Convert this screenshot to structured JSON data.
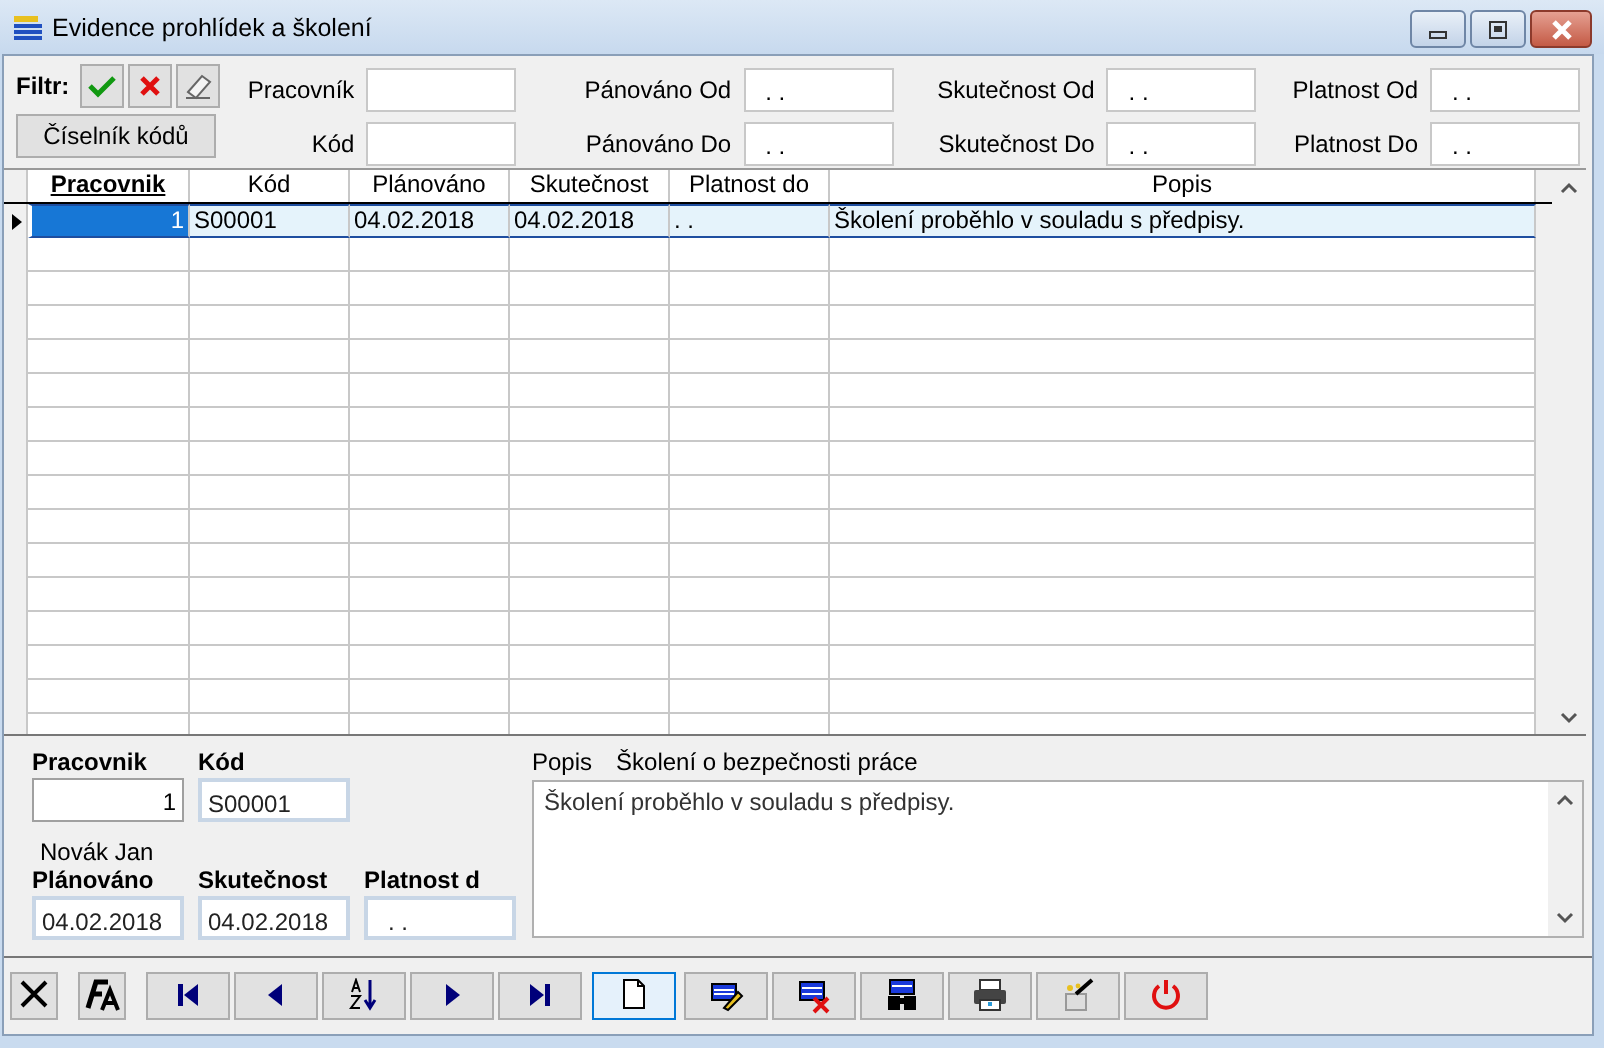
{
  "window": {
    "title": "Evidence prohlídek a školení"
  },
  "filter": {
    "label": "Filtr:",
    "codebook_button": "Číselník kódů",
    "field_groups": [
      {
        "fields": [
          {
            "label": "Pracovník"
          },
          {
            "label": "Kód"
          }
        ]
      },
      {
        "fields": [
          {
            "label": "Pánováno Od",
            "value": ". ."
          },
          {
            "label": "Pánováno Do",
            "value": ". ."
          }
        ]
      },
      {
        "fields": [
          {
            "label": "Skutečnost Od",
            "value": ". ."
          },
          {
            "label": "Skutečnost Do",
            "value": ". ."
          }
        ]
      },
      {
        "fields": [
          {
            "label": "Platnost Od",
            "value": ". ."
          },
          {
            "label": "Platnost Do",
            "value": ". ."
          }
        ]
      }
    ]
  },
  "table": {
    "columns": [
      {
        "label": "Pracovnik",
        "sorted": true
      },
      {
        "label": "Kód",
        "sorted": false
      },
      {
        "label": "Plánováno",
        "sorted": false
      },
      {
        "label": "Skutečnost",
        "sorted": false
      },
      {
        "label": "Platnost do",
        "sorted": false
      },
      {
        "label": "Popis",
        "sorted": false
      }
    ],
    "rows": [
      {
        "selected": true,
        "cells": [
          "1",
          "S00001",
          "04.02.2018",
          "04.02.2018",
          ". .",
          "Školení proběhlo v souladu s předpisy."
        ]
      }
    ]
  },
  "detail": {
    "pracovnik": {
      "label": "Pracovnik",
      "value": "1"
    },
    "kod": {
      "label": "Kód",
      "value": "S00001"
    },
    "employee_name": "Novák Jan",
    "planovano": {
      "label": "Plánováno",
      "value": "04.02.2018"
    },
    "skutecnost": {
      "label": "Skutečnost",
      "value": "04.02.2018"
    },
    "platnost": {
      "label": "Platnost d",
      "value": ". ."
    },
    "popis_label": "Popis",
    "popis_title": "Školení o bezpečnosti práce",
    "popis_text": "Školení proběhlo v souladu s předpisy."
  },
  "toolbar": [
    {
      "kind": "close",
      "focused": false
    },
    {
      "kind": "font",
      "focused": false
    },
    {
      "kind": "first",
      "focused": false
    },
    {
      "kind": "prev",
      "focused": false
    },
    {
      "kind": "sort",
      "focused": false
    },
    {
      "kind": "next",
      "focused": false
    },
    {
      "kind": "last",
      "focused": false
    },
    {
      "kind": "new",
      "focused": true
    },
    {
      "kind": "edit",
      "focused": false
    },
    {
      "kind": "delete",
      "focused": false
    },
    {
      "kind": "find",
      "focused": false
    },
    {
      "kind": "print",
      "focused": false
    },
    {
      "kind": "tools",
      "focused": false
    },
    {
      "kind": "power",
      "focused": false
    }
  ]
}
